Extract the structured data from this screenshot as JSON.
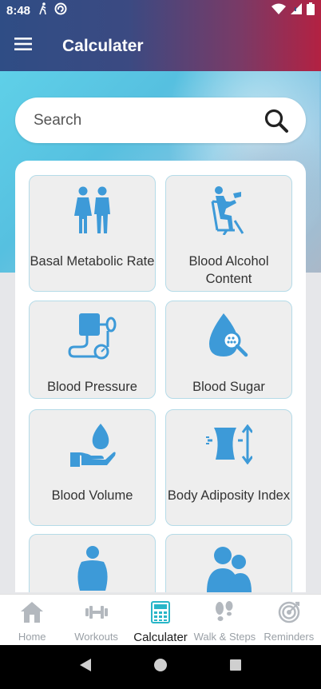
{
  "status_bar": {
    "time": "8:48"
  },
  "app_bar": {
    "title": "Calculater",
    "menu_icon": "hamburger-menu-icon"
  },
  "search": {
    "placeholder": "Search"
  },
  "calculators": [
    {
      "label": "Basal Metabolic Rate",
      "icon": "couple-icon"
    },
    {
      "label": "Blood Alcohol Content",
      "icon": "drinking-person-icon"
    },
    {
      "label": "Blood Pressure",
      "icon": "blood-pressure-monitor-icon"
    },
    {
      "label": "Blood Sugar",
      "icon": "blood-drop-magnifier-icon"
    },
    {
      "label": "Blood Volume",
      "icon": "drop-on-hand-icon"
    },
    {
      "label": "Body Adiposity Index",
      "icon": "waist-measure-icon"
    },
    {
      "label": "",
      "icon": "body-person-icon"
    },
    {
      "label": "",
      "icon": "two-people-icon"
    }
  ],
  "bottom_nav": [
    {
      "label": "Home",
      "icon": "home-icon",
      "active": false
    },
    {
      "label": "Workouts",
      "icon": "dumbbell-icon",
      "active": false
    },
    {
      "label": "Calculater",
      "icon": "calculator-icon",
      "active": true
    },
    {
      "label": "Walk & Steps",
      "icon": "footsteps-icon",
      "active": false
    },
    {
      "label": "Reminders",
      "icon": "target-icon",
      "active": false
    }
  ],
  "colors": {
    "accent": "#3d9ad8",
    "inactive": "#b3b8be",
    "active_nav": "#29b6c8"
  }
}
